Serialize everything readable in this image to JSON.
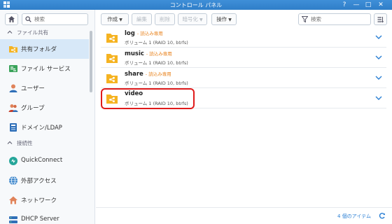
{
  "window": {
    "title": "コントロール パネル",
    "help_label": "?",
    "minimize_label": "—",
    "maximize_label": "□",
    "close_label": "✕"
  },
  "sidebar": {
    "search_placeholder": "検索",
    "sections": [
      {
        "label": "ファイル共有",
        "items": [
          {
            "label": "共有フォルダ",
            "icon": "shared-folder-icon",
            "selected": true
          },
          {
            "label": "ファイル サービス",
            "icon": "file-services-icon"
          },
          {
            "label": "ユーザー",
            "icon": "user-icon"
          },
          {
            "label": "グループ",
            "icon": "group-icon"
          },
          {
            "label": "ドメイン/LDAP",
            "icon": "domain-icon"
          }
        ]
      },
      {
        "label": "接続性",
        "items": [
          {
            "label": "QuickConnect",
            "icon": "quickconnect-icon"
          },
          {
            "label": "外部アクセス",
            "icon": "external-access-icon"
          },
          {
            "label": "ネットワーク",
            "icon": "network-icon"
          },
          {
            "label": "DHCP Server",
            "icon": "dhcp-icon"
          }
        ]
      }
    ]
  },
  "toolbar": {
    "create_label": "作成",
    "edit_label": "編集",
    "delete_label": "削除",
    "encrypt_label": "暗号化",
    "action_label": "操作",
    "search_placeholder": "検索"
  },
  "folders": [
    {
      "name": "log",
      "badge": "- 読込み専用",
      "description": "ボリューム 1 (RAID 10, btrfs)"
    },
    {
      "name": "music",
      "badge": "- 読込み専用",
      "description": "ボリューム 1 (RAID 10, btrfs)"
    },
    {
      "name": "share",
      "badge": "- 読込み専用",
      "description": "ボリューム 1 (RAID 10, btrfs)"
    },
    {
      "name": "video",
      "badge": "",
      "description": "ボリューム 1 (RAID 10, btrfs)"
    }
  ],
  "footer": {
    "item_count": "4 個のアイテム"
  },
  "colors": {
    "titlebar": "#2f7ec8",
    "selected_nav": "#d7e8f8",
    "folder": "#f5b321",
    "read_only": "#e8821c",
    "highlight": "#e01b1b",
    "link": "#2a7fd4"
  }
}
